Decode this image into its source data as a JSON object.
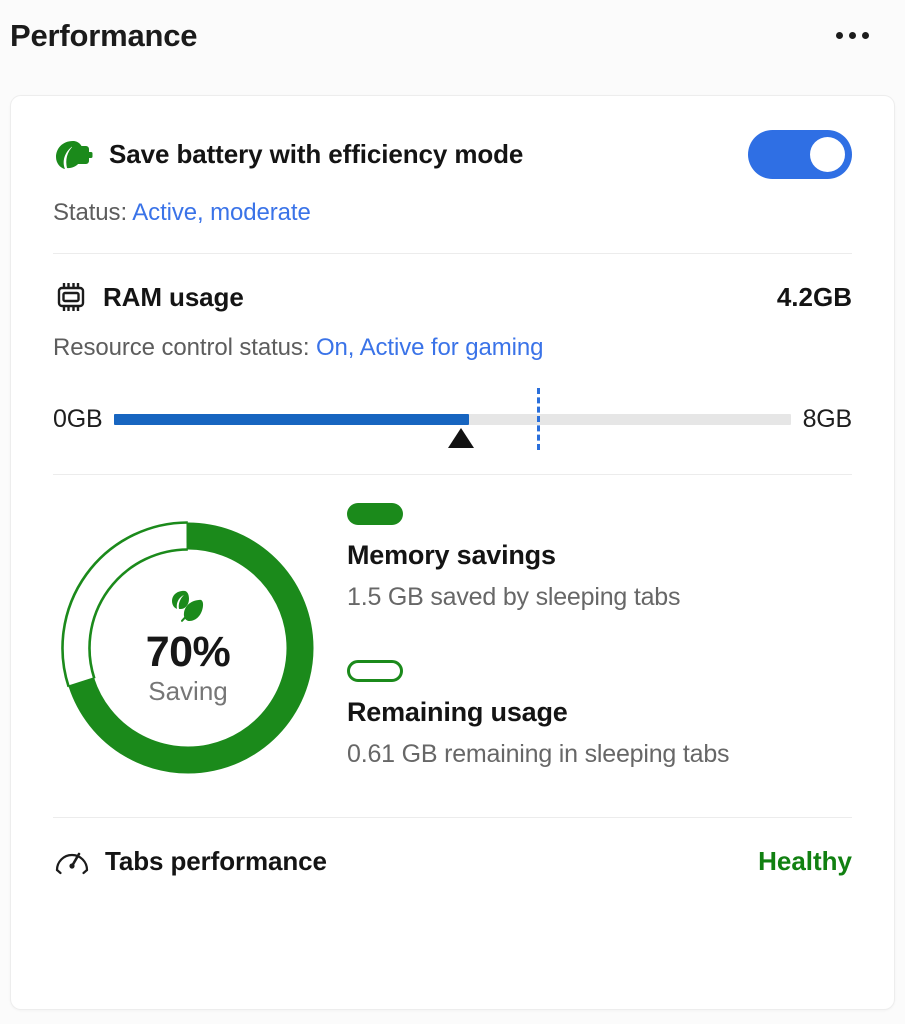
{
  "header": {
    "title": "Performance",
    "menu_icon": "more-options-ellipsis-icon"
  },
  "efficiency": {
    "icon": "battery-leaf-icon",
    "title": "Save battery with efficiency mode",
    "toggle_state": "on",
    "toggle_color": "#2f6fe4",
    "status_label": "Status:",
    "status_value": "Active, moderate",
    "status_link_color": "#3a73e8"
  },
  "ram": {
    "icon": "memory-chip-icon",
    "title": "RAM usage",
    "value": "4.2GB",
    "control_label": "Resource control status:",
    "control_value": "On, Active for gaming",
    "control_link_color": "#3a73e8",
    "slider": {
      "min_label": "0GB",
      "max_label": "8GB",
      "min": 0,
      "max": 8,
      "value": 4.2,
      "threshold": 5.0,
      "fill_color": "#1765c0",
      "track_color": "#e6e6e6",
      "threshold_color": "#2a6fdb"
    }
  },
  "chart_data": {
    "type": "pie",
    "title": "Memory savings",
    "center_value": "70%",
    "center_label": "Saving",
    "center_icon": "leaf-icon",
    "categories": [
      "Memory savings",
      "Remaining usage"
    ],
    "values": [
      70,
      30
    ],
    "units": "percent",
    "colors": [
      "#1b8a1b",
      "#ffffff"
    ],
    "legend_position": "right",
    "series": [
      {
        "name": "Memory savings",
        "value": 70,
        "amount_gb": 1.5,
        "swatch": "filled",
        "description": "1.5 GB saved by sleeping tabs"
      },
      {
        "name": "Remaining usage",
        "value": 30,
        "amount_gb": 0.61,
        "swatch": "outline",
        "description": "0.61 GB remaining in sleeping tabs"
      }
    ]
  },
  "legend": {
    "items": [
      {
        "swatch_name": "legend-swatch-memory-savings",
        "title": "Memory savings",
        "description": "1.5 GB saved by sleeping tabs"
      },
      {
        "swatch_name": "legend-swatch-remaining-usage",
        "title": "Remaining usage",
        "description": "0.61 GB remaining in sleeping tabs"
      }
    ]
  },
  "tabs_performance": {
    "icon": "speedometer-icon",
    "title": "Tabs performance",
    "status": "Healthy",
    "status_color": "#118011"
  }
}
